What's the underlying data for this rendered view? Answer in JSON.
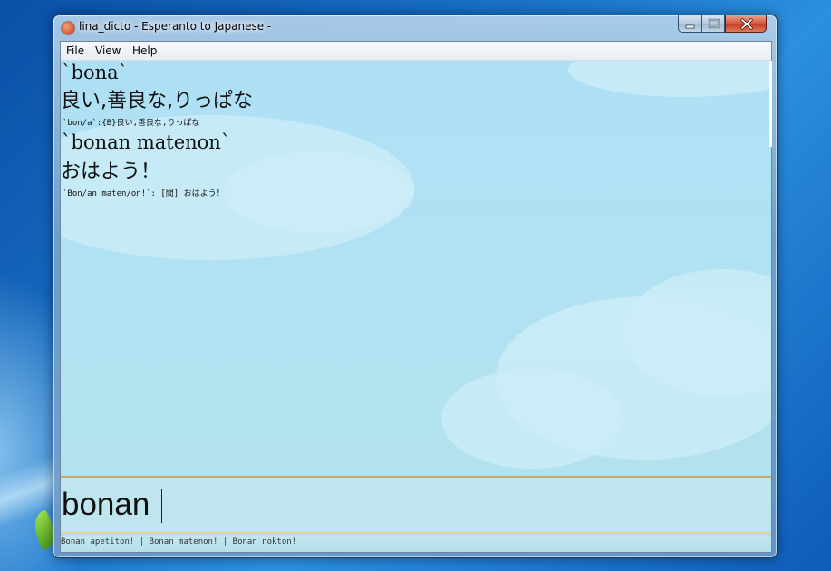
{
  "window": {
    "title": "lina_dicto - Esperanto to Japanese -",
    "controls": [
      "minimize",
      "maximize",
      "close"
    ]
  },
  "menubar": {
    "items": [
      {
        "label": "File"
      },
      {
        "label": "View"
      },
      {
        "label": "Help"
      }
    ]
  },
  "results": [
    {
      "word": "`bona`",
      "translation": "良い,善良な,りっぱな",
      "raw": "`bon/a`:{B}良い,善良な,りっぱな"
    },
    {
      "word": "`bonan matenon`",
      "translation": "おはよう！",
      "raw": "`Bon/an maten/on!`: [間] おはよう！"
    }
  ],
  "input": {
    "value": "bonan "
  },
  "status": {
    "suggestions": "Bonan apetiton! | Bonan matenon! | Bonan nokton!"
  },
  "colors": {
    "sky": "#b2e2f2",
    "input_border": "#c9a66b",
    "close_button": "#d4543a"
  }
}
